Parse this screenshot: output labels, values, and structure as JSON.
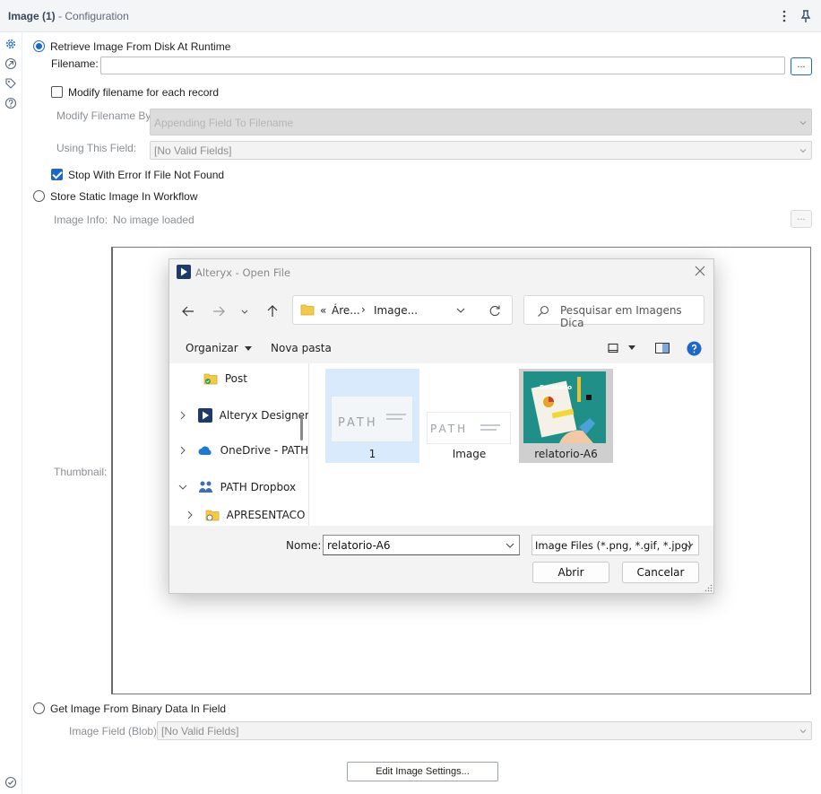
{
  "header": {
    "title_main": "Image (1)",
    "title_sub": "- Configuration"
  },
  "options": {
    "retrieve_label": "Retrieve Image From Disk At Runtime",
    "filename_label": "Filename:",
    "filename_value": "",
    "browse_label": "...",
    "modify_filename_label": "Modify filename for each record",
    "modify_by_label": "Modify Filename By:",
    "modify_by_value": "Appending Field To Filename",
    "using_field_label": "Using This Field:",
    "using_field_value": "[No Valid Fields]",
    "stop_error_label": "Stop With Error If File Not Found",
    "store_static_label": "Store Static Image In Workflow",
    "image_info_label": "Image Info:",
    "image_info_value": "No image loaded",
    "image_info_browse": "...",
    "thumbnail_label": "Thumbnail:",
    "binary_label": "Get Image From Binary Data In Field",
    "blob_label": "Image Field (Blob):",
    "blob_value": "[No Valid Fields]",
    "edit_settings_label": "Edit Image Settings..."
  },
  "state": {
    "retrieve_selected": true,
    "modify_filename_checked": false,
    "stop_error_checked": true,
    "store_static_selected": false,
    "binary_selected": false
  },
  "dialog": {
    "title": "Alteryx - Open File",
    "breadcrumb_prefix": "«",
    "breadcrumb_1": "Áre...",
    "breadcrumb_sep": "›",
    "breadcrumb_2": "Image...",
    "search_placeholder": "Pesquisar em Imagens Dica",
    "organize_label": "Organizar",
    "new_folder_label": "Nova pasta",
    "nav_items": [
      {
        "label": "Post",
        "icon": "folder-check-icon"
      },
      {
        "label": "Alteryx Designer",
        "icon": "alteryx-icon"
      },
      {
        "label": "OneDrive - PATH",
        "icon": "onedrive-cloud-icon"
      },
      {
        "label": "PATH Dropbox",
        "icon": "dropbox-icon"
      },
      {
        "label": "APRESENTACO",
        "icon": "folder-sync-icon"
      }
    ],
    "files": [
      {
        "name": "1",
        "thumbnail": "path-logo-thumbnail"
      },
      {
        "name": "Image",
        "thumbnail": "path-logo-thumbnail"
      },
      {
        "name": "relatorio-A6",
        "thumbnail": "relatorio-illustration-thumbnail"
      }
    ],
    "thumb_logo_text": "PATH",
    "thumb_relatorio_text": "Relatório",
    "name_label": "Nome:",
    "name_value": "relatorio-A6",
    "file_type_value": "Image Files (*.png, *.gif, *.jpg)",
    "open_label": "Abrir",
    "cancel_label": "Cancelar"
  },
  "colors": {
    "accent": "#1d67c9",
    "disabled_field": "#dcdcdc",
    "dialog_bg": "#f3f3f3",
    "selected_tile": "#d9eafc",
    "thumbnail_teal": "#1f8f88"
  }
}
